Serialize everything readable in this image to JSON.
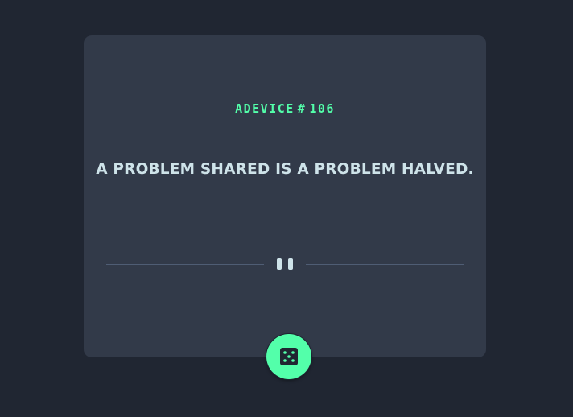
{
  "card": {
    "advice_label": "ADEVICE",
    "advice_hash": "#",
    "advice_number": "106",
    "quote": "A PROBLEM SHARED IS A PROBLEM HALVED."
  },
  "colors": {
    "background": "#202632",
    "card": "#323a49",
    "accent": "#53ffaa",
    "text": "#cee3e9",
    "divider": "#4f5d74"
  },
  "icons": {
    "divider": "pause-icon",
    "button": "dice-icon"
  }
}
